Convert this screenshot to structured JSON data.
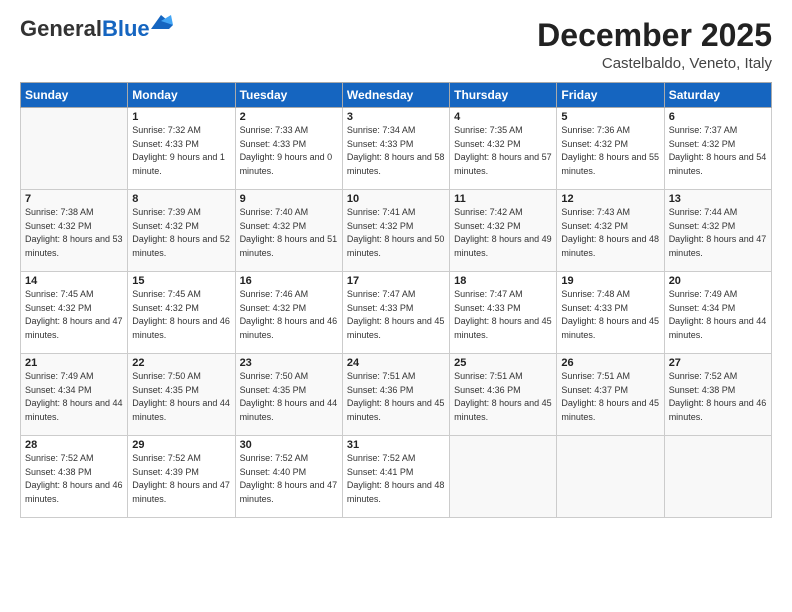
{
  "logo": {
    "general": "General",
    "blue": "Blue"
  },
  "header": {
    "month": "December 2025",
    "location": "Castelbaldo, Veneto, Italy"
  },
  "days_of_week": [
    "Sunday",
    "Monday",
    "Tuesday",
    "Wednesday",
    "Thursday",
    "Friday",
    "Saturday"
  ],
  "weeks": [
    [
      {
        "day": "",
        "sunrise": "",
        "sunset": "",
        "daylight": "",
        "empty": true
      },
      {
        "day": "1",
        "sunrise": "Sunrise: 7:32 AM",
        "sunset": "Sunset: 4:33 PM",
        "daylight": "Daylight: 9 hours and 1 minute."
      },
      {
        "day": "2",
        "sunrise": "Sunrise: 7:33 AM",
        "sunset": "Sunset: 4:33 PM",
        "daylight": "Daylight: 9 hours and 0 minutes."
      },
      {
        "day": "3",
        "sunrise": "Sunrise: 7:34 AM",
        "sunset": "Sunset: 4:33 PM",
        "daylight": "Daylight: 8 hours and 58 minutes."
      },
      {
        "day": "4",
        "sunrise": "Sunrise: 7:35 AM",
        "sunset": "Sunset: 4:32 PM",
        "daylight": "Daylight: 8 hours and 57 minutes."
      },
      {
        "day": "5",
        "sunrise": "Sunrise: 7:36 AM",
        "sunset": "Sunset: 4:32 PM",
        "daylight": "Daylight: 8 hours and 55 minutes."
      },
      {
        "day": "6",
        "sunrise": "Sunrise: 7:37 AM",
        "sunset": "Sunset: 4:32 PM",
        "daylight": "Daylight: 8 hours and 54 minutes."
      }
    ],
    [
      {
        "day": "7",
        "sunrise": "Sunrise: 7:38 AM",
        "sunset": "Sunset: 4:32 PM",
        "daylight": "Daylight: 8 hours and 53 minutes."
      },
      {
        "day": "8",
        "sunrise": "Sunrise: 7:39 AM",
        "sunset": "Sunset: 4:32 PM",
        "daylight": "Daylight: 8 hours and 52 minutes."
      },
      {
        "day": "9",
        "sunrise": "Sunrise: 7:40 AM",
        "sunset": "Sunset: 4:32 PM",
        "daylight": "Daylight: 8 hours and 51 minutes."
      },
      {
        "day": "10",
        "sunrise": "Sunrise: 7:41 AM",
        "sunset": "Sunset: 4:32 PM",
        "daylight": "Daylight: 8 hours and 50 minutes."
      },
      {
        "day": "11",
        "sunrise": "Sunrise: 7:42 AM",
        "sunset": "Sunset: 4:32 PM",
        "daylight": "Daylight: 8 hours and 49 minutes."
      },
      {
        "day": "12",
        "sunrise": "Sunrise: 7:43 AM",
        "sunset": "Sunset: 4:32 PM",
        "daylight": "Daylight: 8 hours and 48 minutes."
      },
      {
        "day": "13",
        "sunrise": "Sunrise: 7:44 AM",
        "sunset": "Sunset: 4:32 PM",
        "daylight": "Daylight: 8 hours and 47 minutes."
      }
    ],
    [
      {
        "day": "14",
        "sunrise": "Sunrise: 7:45 AM",
        "sunset": "Sunset: 4:32 PM",
        "daylight": "Daylight: 8 hours and 47 minutes."
      },
      {
        "day": "15",
        "sunrise": "Sunrise: 7:45 AM",
        "sunset": "Sunset: 4:32 PM",
        "daylight": "Daylight: 8 hours and 46 minutes."
      },
      {
        "day": "16",
        "sunrise": "Sunrise: 7:46 AM",
        "sunset": "Sunset: 4:32 PM",
        "daylight": "Daylight: 8 hours and 46 minutes."
      },
      {
        "day": "17",
        "sunrise": "Sunrise: 7:47 AM",
        "sunset": "Sunset: 4:33 PM",
        "daylight": "Daylight: 8 hours and 45 minutes."
      },
      {
        "day": "18",
        "sunrise": "Sunrise: 7:47 AM",
        "sunset": "Sunset: 4:33 PM",
        "daylight": "Daylight: 8 hours and 45 minutes."
      },
      {
        "day": "19",
        "sunrise": "Sunrise: 7:48 AM",
        "sunset": "Sunset: 4:33 PM",
        "daylight": "Daylight: 8 hours and 45 minutes."
      },
      {
        "day": "20",
        "sunrise": "Sunrise: 7:49 AM",
        "sunset": "Sunset: 4:34 PM",
        "daylight": "Daylight: 8 hours and 44 minutes."
      }
    ],
    [
      {
        "day": "21",
        "sunrise": "Sunrise: 7:49 AM",
        "sunset": "Sunset: 4:34 PM",
        "daylight": "Daylight: 8 hours and 44 minutes."
      },
      {
        "day": "22",
        "sunrise": "Sunrise: 7:50 AM",
        "sunset": "Sunset: 4:35 PM",
        "daylight": "Daylight: 8 hours and 44 minutes."
      },
      {
        "day": "23",
        "sunrise": "Sunrise: 7:50 AM",
        "sunset": "Sunset: 4:35 PM",
        "daylight": "Daylight: 8 hours and 44 minutes."
      },
      {
        "day": "24",
        "sunrise": "Sunrise: 7:51 AM",
        "sunset": "Sunset: 4:36 PM",
        "daylight": "Daylight: 8 hours and 45 minutes."
      },
      {
        "day": "25",
        "sunrise": "Sunrise: 7:51 AM",
        "sunset": "Sunset: 4:36 PM",
        "daylight": "Daylight: 8 hours and 45 minutes."
      },
      {
        "day": "26",
        "sunrise": "Sunrise: 7:51 AM",
        "sunset": "Sunset: 4:37 PM",
        "daylight": "Daylight: 8 hours and 45 minutes."
      },
      {
        "day": "27",
        "sunrise": "Sunrise: 7:52 AM",
        "sunset": "Sunset: 4:38 PM",
        "daylight": "Daylight: 8 hours and 46 minutes."
      }
    ],
    [
      {
        "day": "28",
        "sunrise": "Sunrise: 7:52 AM",
        "sunset": "Sunset: 4:38 PM",
        "daylight": "Daylight: 8 hours and 46 minutes."
      },
      {
        "day": "29",
        "sunrise": "Sunrise: 7:52 AM",
        "sunset": "Sunset: 4:39 PM",
        "daylight": "Daylight: 8 hours and 47 minutes."
      },
      {
        "day": "30",
        "sunrise": "Sunrise: 7:52 AM",
        "sunset": "Sunset: 4:40 PM",
        "daylight": "Daylight: 8 hours and 47 minutes."
      },
      {
        "day": "31",
        "sunrise": "Sunrise: 7:52 AM",
        "sunset": "Sunset: 4:41 PM",
        "daylight": "Daylight: 8 hours and 48 minutes."
      },
      {
        "day": "",
        "sunrise": "",
        "sunset": "",
        "daylight": "",
        "empty": true
      },
      {
        "day": "",
        "sunrise": "",
        "sunset": "",
        "daylight": "",
        "empty": true
      },
      {
        "day": "",
        "sunrise": "",
        "sunset": "",
        "daylight": "",
        "empty": true
      }
    ]
  ]
}
